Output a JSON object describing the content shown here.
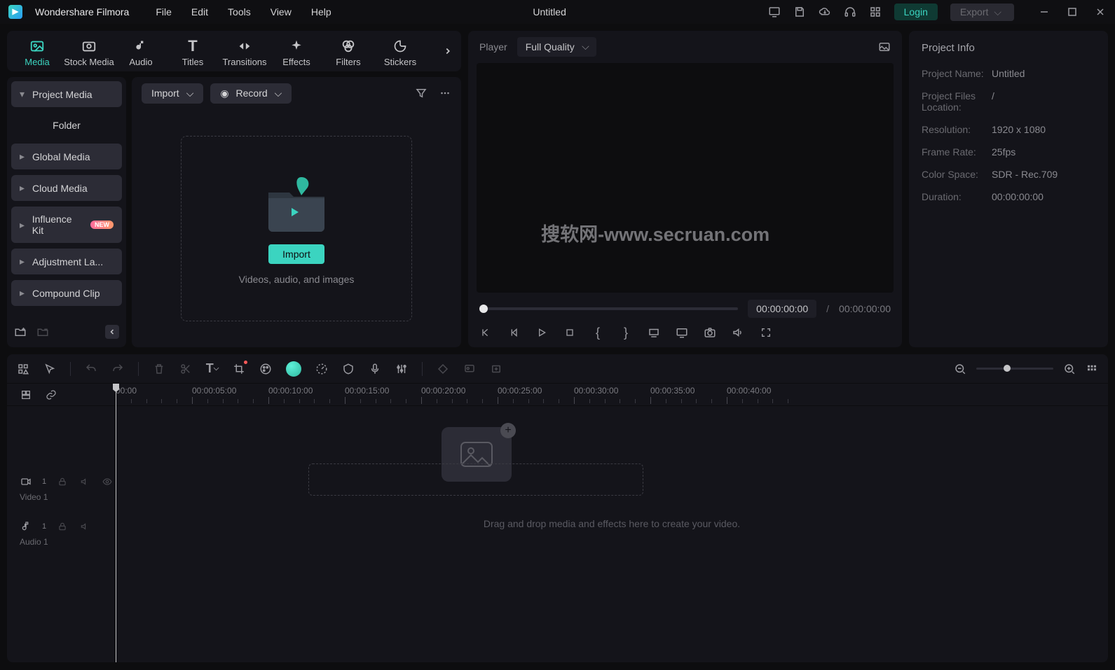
{
  "app": {
    "name": "Wondershare Filmora"
  },
  "menubar": [
    "File",
    "Edit",
    "Tools",
    "View",
    "Help"
  ],
  "title": "Untitled",
  "login_label": "Login",
  "export_label": "Export",
  "tabs": [
    {
      "label": "Media"
    },
    {
      "label": "Stock Media"
    },
    {
      "label": "Audio"
    },
    {
      "label": "Titles"
    },
    {
      "label": "Transitions"
    },
    {
      "label": "Effects"
    },
    {
      "label": "Filters"
    },
    {
      "label": "Stickers"
    }
  ],
  "sidebar": {
    "items": [
      {
        "label": "Project Media"
      },
      {
        "label": "Folder"
      },
      {
        "label": "Global Media"
      },
      {
        "label": "Cloud Media"
      },
      {
        "label": "Influence Kit",
        "badge": "NEW"
      },
      {
        "label": "Adjustment La..."
      },
      {
        "label": "Compound Clip"
      }
    ]
  },
  "content": {
    "import_label": "Import",
    "record_label": "Record",
    "import_btn": "Import",
    "hint": "Videos, audio, and images"
  },
  "player": {
    "header_label": "Player",
    "quality": "Full Quality",
    "watermark": "搜软网-www.secruan.com",
    "time_current": "00:00:00:00",
    "time_total": "00:00:00:00",
    "sep": "/"
  },
  "info": {
    "title": "Project Info",
    "rows": [
      {
        "label": "Project Name:",
        "value": "Untitled"
      },
      {
        "label": "Project Files Location:",
        "value": "/"
      },
      {
        "label": "Resolution:",
        "value": "1920 x 1080"
      },
      {
        "label": "Frame Rate:",
        "value": "25fps"
      },
      {
        "label": "Color Space:",
        "value": "SDR - Rec.709"
      },
      {
        "label": "Duration:",
        "value": "00:00:00:00"
      }
    ]
  },
  "timeline": {
    "ticks": [
      "00:00",
      "00:00:05:00",
      "00:00:10:00",
      "00:00:15:00",
      "00:00:20:00",
      "00:00:25:00",
      "00:00:30:00",
      "00:00:35:00",
      "00:00:40:00"
    ],
    "tracks": [
      {
        "label": "Video 1",
        "badge": "1"
      },
      {
        "label": "Audio 1",
        "badge": "1"
      }
    ],
    "hint": "Drag and drop media and effects here to create your video."
  }
}
